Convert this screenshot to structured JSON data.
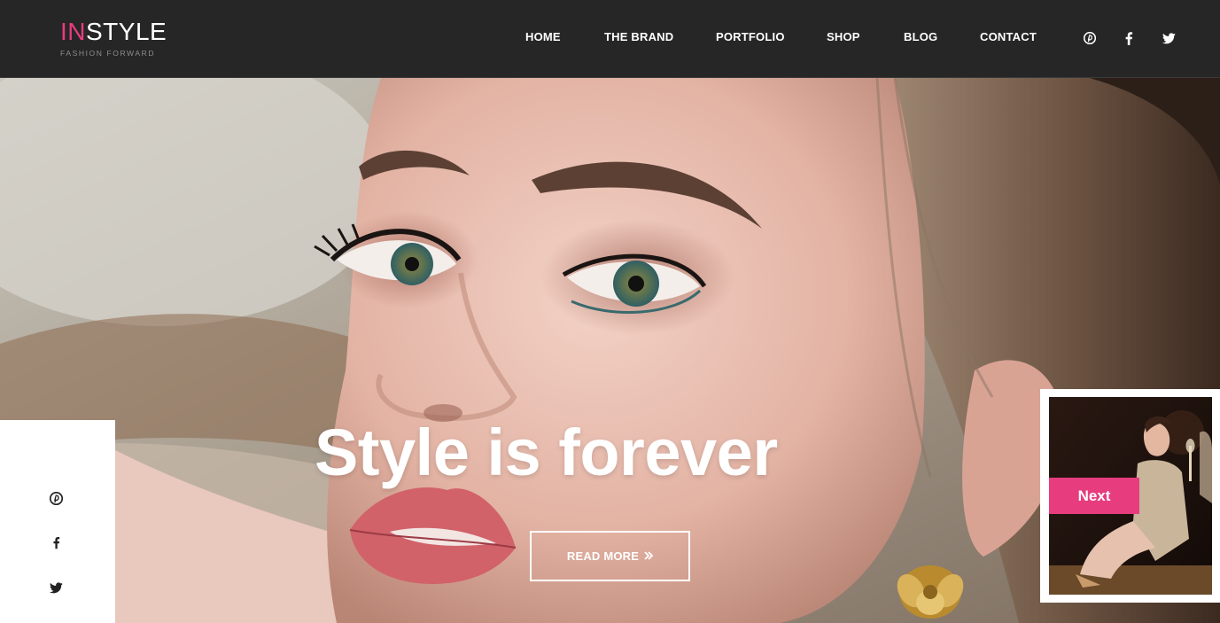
{
  "brand": {
    "name_accent": "IN",
    "name_rest": "STYLE",
    "tagline": "FASHION FORWARD",
    "accent_color": "#e73c7e"
  },
  "nav": {
    "items": [
      {
        "label": "HOME"
      },
      {
        "label": "THE BRAND"
      },
      {
        "label": "PORTFOLIO"
      },
      {
        "label": "SHOP"
      },
      {
        "label": "BLOG"
      },
      {
        "label": "CONTACT"
      }
    ]
  },
  "header_social": {
    "icons": [
      "pinterest-icon",
      "facebook-icon",
      "twitter-icon"
    ]
  },
  "hero": {
    "title": "Style is forever",
    "read_more_label": "READ MORE",
    "read_more_icon": "double-chevron-right-icon"
  },
  "side_social": {
    "icons": [
      "pinterest-icon",
      "facebook-icon",
      "twitter-icon"
    ]
  },
  "next_slide": {
    "label": "Next"
  },
  "colors": {
    "header_bg": "#262626",
    "accent": "#e73c7e",
    "text_light": "#ffffff"
  }
}
